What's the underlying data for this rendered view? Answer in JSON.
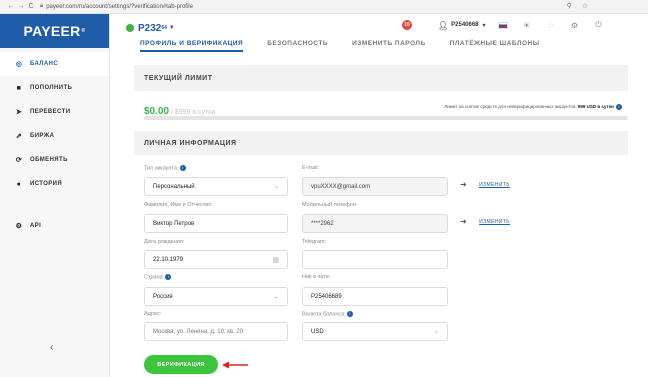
{
  "browser": {
    "url": "payeer.com/ru/account/settings/?verification#tab-profile",
    "back": "←",
    "forward": "→",
    "reload": "C"
  },
  "sidebar": {
    "logo": "PAYEER",
    "logo_mark": "®",
    "items": [
      {
        "label": "БАЛАНС",
        "icon": "wallet-icon"
      },
      {
        "label": "ПОПОЛНИТЬ",
        "icon": "deposit-icon"
      },
      {
        "label": "ПЕРЕВЕСТИ",
        "icon": "send-icon"
      },
      {
        "label": "БИРЖА",
        "icon": "chart-icon"
      },
      {
        "label": "ОБМЕНЯТЬ",
        "icon": "exchange-icon"
      },
      {
        "label": "ИСТОРИЯ",
        "icon": "history-icon"
      },
      {
        "label": "API",
        "icon": "api-icon"
      }
    ],
    "collapse": "‹"
  },
  "header": {
    "balance": "P232",
    "balance_cents": "64",
    "notifications": "10",
    "account_id": "P2540668"
  },
  "tabs": [
    {
      "label": "ПРОФИЛЬ И ВЕРИФИКАЦИЯ",
      "active": true
    },
    {
      "label": "БЕЗОПАСНОСТЬ",
      "active": false
    },
    {
      "label": "ИЗМЕНИТЬ ПАРОЛЬ",
      "active": false
    },
    {
      "label": "ПЛАТЁЖНЫЕ ШАБЛОНЫ",
      "active": false
    }
  ],
  "limit": {
    "title": "ТЕКУЩИЙ ЛИМИТ",
    "used": "$0.00",
    "total": " / $999 в сутки",
    "note": "Лимит на снятие средств для неверифицированных аккаунтов: ",
    "note_value": "999 USD в сутки",
    "progress": 0
  },
  "personal": {
    "title": "ЛИЧНАЯ ИНФОРМАЦИЯ",
    "account_type_label": "Тип аккаунта:",
    "account_type": "Персональный",
    "email_label": "E-mail:",
    "email": "vpuXXXX@gmail.com",
    "name_label": "Фамилия, Имя и Отчество:",
    "name": "Виктор Петров",
    "phone_label": "Мобильный телефон:",
    "phone": "****2962",
    "birth_label": "Дата рождения:",
    "birth": "22.10.1979",
    "telegram_label": "Telegram:",
    "telegram": "",
    "country_label": "Страна:",
    "country": "Россия",
    "nick_label": "Ник в чате:",
    "nick": "P25406689",
    "address_label": "Адрес:",
    "address": "Москва, ул. Ленина, д. 10, кв. 20",
    "currency_label": "Валюта баланса:",
    "currency": "USD",
    "change": "ИЗМЕНИТЬ",
    "verify": "ВЕРИФИКАЦИЯ"
  },
  "colors": {
    "brand": "#1f5ca8",
    "accent_green": "#3cc43c",
    "arrow_red": "#e0201f"
  }
}
